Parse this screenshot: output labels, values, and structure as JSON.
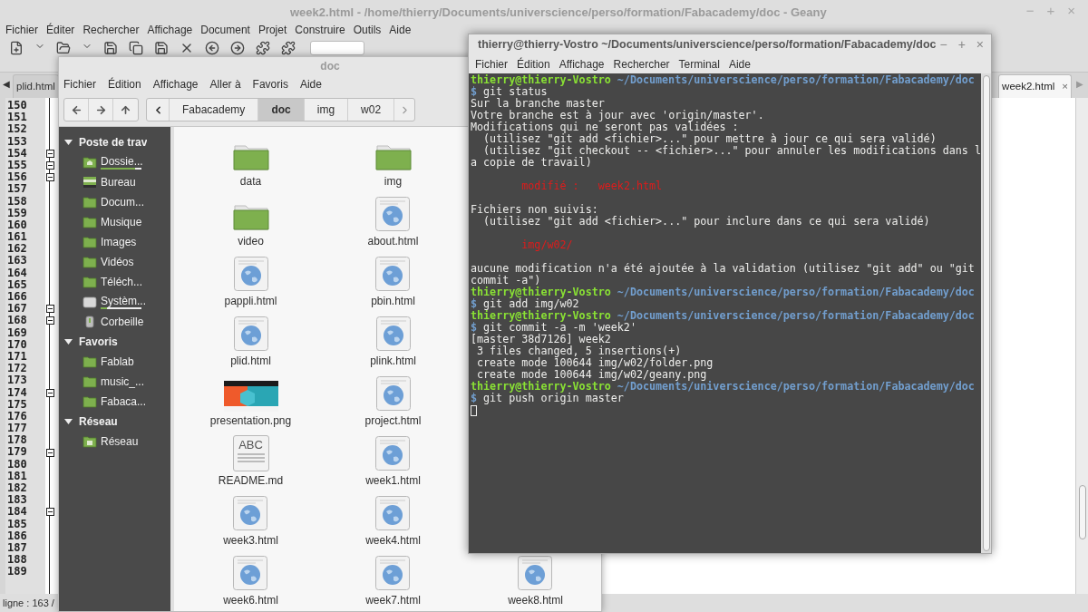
{
  "editor": {
    "title": "week2.html - /home/thierry/Documents/universcience/perso/formation/Fabacademy/doc - Geany",
    "controls": [
      "−",
      "+",
      "×"
    ],
    "menu": [
      "Fichier",
      "Éditer",
      "Rechercher",
      "Affichage",
      "Document",
      "Projet",
      "Construire",
      "Outils",
      "Aide"
    ],
    "tab_scroll_left": "◀",
    "tab_scroll_right": "▶",
    "tabs": [
      {
        "label": "plid.html",
        "selected": false
      },
      {
        "label": "week2.html",
        "selected": true,
        "close": "×"
      }
    ],
    "lines": [
      {
        "n": "150",
        "fold": false
      },
      {
        "n": "151",
        "fold": false
      },
      {
        "n": "152",
        "fold": false
      },
      {
        "n": "153",
        "fold": false
      },
      {
        "n": "154",
        "fold": true
      },
      {
        "n": "155",
        "fold": true
      },
      {
        "n": "156",
        "fold": true
      },
      {
        "n": "157",
        "fold": false
      },
      {
        "n": "158",
        "fold": false
      },
      {
        "n": "159",
        "fold": false
      },
      {
        "n": "160",
        "fold": false
      },
      {
        "n": "161",
        "fold": false
      },
      {
        "n": "162",
        "fold": false
      },
      {
        "n": "163",
        "fold": false
      },
      {
        "n": "164",
        "fold": false
      },
      {
        "n": "165",
        "fold": false
      },
      {
        "n": "166",
        "fold": false
      },
      {
        "n": "167",
        "fold": true
      },
      {
        "n": "168",
        "fold": true
      },
      {
        "n": "169",
        "fold": false
      },
      {
        "n": "170",
        "fold": false
      },
      {
        "n": "171",
        "fold": false
      },
      {
        "n": "172",
        "fold": false
      },
      {
        "n": "173",
        "fold": false
      },
      {
        "n": "174",
        "fold": true
      },
      {
        "n": "175",
        "fold": false
      },
      {
        "n": "176",
        "fold": false
      },
      {
        "n": "177",
        "fold": false
      },
      {
        "n": "178",
        "fold": false
      },
      {
        "n": "179",
        "fold": true
      },
      {
        "n": "180",
        "fold": false
      },
      {
        "n": "181",
        "fold": false
      },
      {
        "n": "182",
        "fold": false
      },
      {
        "n": "183",
        "fold": false
      },
      {
        "n": "184",
        "fold": true
      },
      {
        "n": "185",
        "fold": false
      },
      {
        "n": "186",
        "fold": false
      },
      {
        "n": "187",
        "fold": false
      },
      {
        "n": "188",
        "fold": false
      },
      {
        "n": "189",
        "fold": false
      }
    ],
    "status": "ligne : 163 /"
  },
  "file_manager": {
    "title": "doc",
    "menu": [
      "Fichier",
      "Édition",
      "Affichage",
      "Aller à",
      "Favoris",
      "Aide"
    ],
    "path": [
      {
        "label": "Fabacademy",
        "selected": false
      },
      {
        "label": "doc",
        "selected": true
      },
      {
        "label": "img",
        "selected": false
      },
      {
        "label": "w02",
        "selected": false
      }
    ],
    "sidebar": [
      {
        "label": "Poste de trav",
        "items": [
          {
            "label": "Dossie...",
            "kind": "home",
            "level": 0.85
          },
          {
            "label": "Bureau",
            "kind": "desktop"
          },
          {
            "label": "Docum...",
            "kind": "folder"
          },
          {
            "label": "Musique",
            "kind": "folder"
          },
          {
            "label": "Images",
            "kind": "folder"
          },
          {
            "label": "Vidéos",
            "kind": "folder"
          },
          {
            "label": "Téléch...",
            "kind": "folder"
          },
          {
            "label": "Systèm...",
            "kind": "drive",
            "level": 0.15
          },
          {
            "label": "Corbeille",
            "kind": "trash"
          }
        ]
      },
      {
        "label": "Favoris",
        "items": [
          {
            "label": "Fablab",
            "kind": "folder"
          },
          {
            "label": "music_...",
            "kind": "folder"
          },
          {
            "label": "Fabaca...",
            "kind": "folder"
          }
        ]
      },
      {
        "label": "Réseau",
        "items": [
          {
            "label": "Réseau",
            "kind": "network"
          }
        ]
      }
    ],
    "rows": [
      [
        {
          "name": "data",
          "kind": "folder"
        },
        {
          "name": "img",
          "kind": "folder"
        }
      ],
      [
        {
          "name": "video",
          "kind": "folder"
        },
        {
          "name": "about.html",
          "kind": "html"
        }
      ],
      [
        {
          "name": "pappli.html",
          "kind": "html"
        },
        {
          "name": "pbin.html",
          "kind": "html"
        }
      ],
      [
        {
          "name": "plid.html",
          "kind": "html"
        },
        {
          "name": "plink.html",
          "kind": "html"
        }
      ],
      [
        {
          "name": "presentation.png"
        },
        {
          "name": "project.html",
          "kind": "html"
        }
      ],
      [
        {
          "name": "README.md",
          "kind": "text",
          "icon_text": "ABC"
        },
        {
          "name": "week1.html",
          "kind": "html"
        }
      ],
      [
        {
          "name": "week3.html",
          "kind": "html"
        },
        {
          "name": "week4.html",
          "kind": "html"
        }
      ],
      [
        {
          "name": "week6.html",
          "kind": "html"
        },
        {
          "name": "week7.html",
          "kind": "html"
        },
        {
          "name": "week8.html",
          "kind": "html"
        }
      ]
    ]
  },
  "terminal": {
    "title": "thierry@thierry-Vostro ~/Documents/universcience/perso/formation/Fabacademy/doc",
    "controls": [
      "−",
      "+",
      "×"
    ],
    "menu": [
      "Fichier",
      "Édition",
      "Affichage",
      "Rechercher",
      "Terminal",
      "Aide"
    ],
    "lines": [
      {
        "kind": "prompt",
        "user": "thierry@thierry-Vostro",
        "path": "~/Documents/universcience/perso/formation/Fabacademy/doc"
      },
      {
        "kind": "command",
        "sign": "$",
        "text": "git status"
      },
      {
        "kind": "output",
        "text": "Sur la branche master"
      },
      {
        "kind": "output",
        "text": "Votre branche est à jour avec 'origin/master'."
      },
      {
        "kind": "output",
        "text": "Modifications qui ne seront pas validées :"
      },
      {
        "kind": "output",
        "text": "  (utilisez \"git add <fichier>...\" pour mettre à jour ce qui sera validé)"
      },
      {
        "kind": "output",
        "text": "  (utilisez \"git checkout -- <fichier>...\" pour annuler les modifications dans l"
      },
      {
        "kind": "output",
        "text": "a copie de travail)"
      },
      {
        "kind": "blank"
      },
      {
        "kind": "error",
        "text": "        modifié :   week2.html"
      },
      {
        "kind": "blank"
      },
      {
        "kind": "output",
        "text": "Fichiers non suivis:"
      },
      {
        "kind": "output",
        "text": "  (utilisez \"git add <fichier>...\" pour inclure dans ce qui sera validé)"
      },
      {
        "kind": "blank"
      },
      {
        "kind": "error",
        "text": "        img/w02/"
      },
      {
        "kind": "blank"
      },
      {
        "kind": "output",
        "text": "aucune modification n'a été ajoutée à la validation (utilisez \"git add\" ou \"git"
      },
      {
        "kind": "output",
        "text": "commit -a\")"
      },
      {
        "kind": "prompt",
        "user": "thierry@thierry-Vostro",
        "path": "~/Documents/universcience/perso/formation/Fabacademy/doc"
      },
      {
        "kind": "command",
        "sign": "$",
        "text": "git add img/w02"
      },
      {
        "kind": "prompt",
        "user": "thierry@thierry-Vostro",
        "path": "~/Documents/universcience/perso/formation/Fabacademy/doc"
      },
      {
        "kind": "command",
        "sign": "$",
        "text": "git commit -a -m 'week2'"
      },
      {
        "kind": "output",
        "text": "[master 38d7126] week2"
      },
      {
        "kind": "output",
        "text": " 3 files changed, 5 insertions(+)"
      },
      {
        "kind": "output",
        "text": " create mode 100644 img/w02/folder.png"
      },
      {
        "kind": "output",
        "text": " create mode 100644 img/w02/geany.png"
      },
      {
        "kind": "prompt",
        "user": "thierry@thierry-Vostro",
        "path": "~/Documents/universcience/perso/formation/Fabacademy/doc"
      },
      {
        "kind": "command",
        "sign": "$",
        "text": "git push origin master"
      },
      {
        "kind": "cursor"
      }
    ]
  }
}
